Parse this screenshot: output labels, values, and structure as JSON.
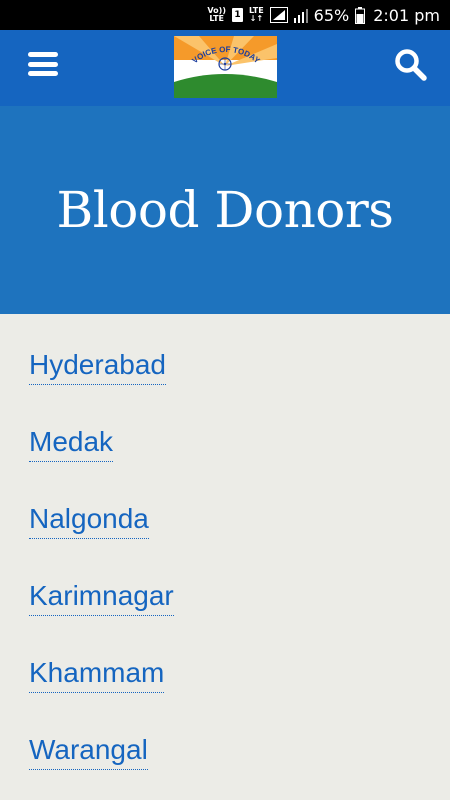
{
  "status_bar": {
    "volte_top": "Vo))",
    "volte_bottom": "LTE",
    "sim_number": "1",
    "lte_label": "LTE",
    "battery_percent": "65%",
    "time": "2:01 pm"
  },
  "app_bar": {
    "logo_text": "VOICE OF TODAY",
    "icons": {
      "menu": "hamburger-menu-icon",
      "search": "search-icon"
    }
  },
  "hero": {
    "title": "Blood Donors"
  },
  "districts": [
    {
      "label": "Hyderabad"
    },
    {
      "label": "Medak"
    },
    {
      "label": "Nalgonda"
    },
    {
      "label": "Karimnagar"
    },
    {
      "label": "Khammam"
    },
    {
      "label": "Warangal"
    }
  ],
  "colors": {
    "app_bar": "#1565c0",
    "hero": "#1e73be",
    "link": "#1565c0",
    "background": "#ecece7"
  }
}
